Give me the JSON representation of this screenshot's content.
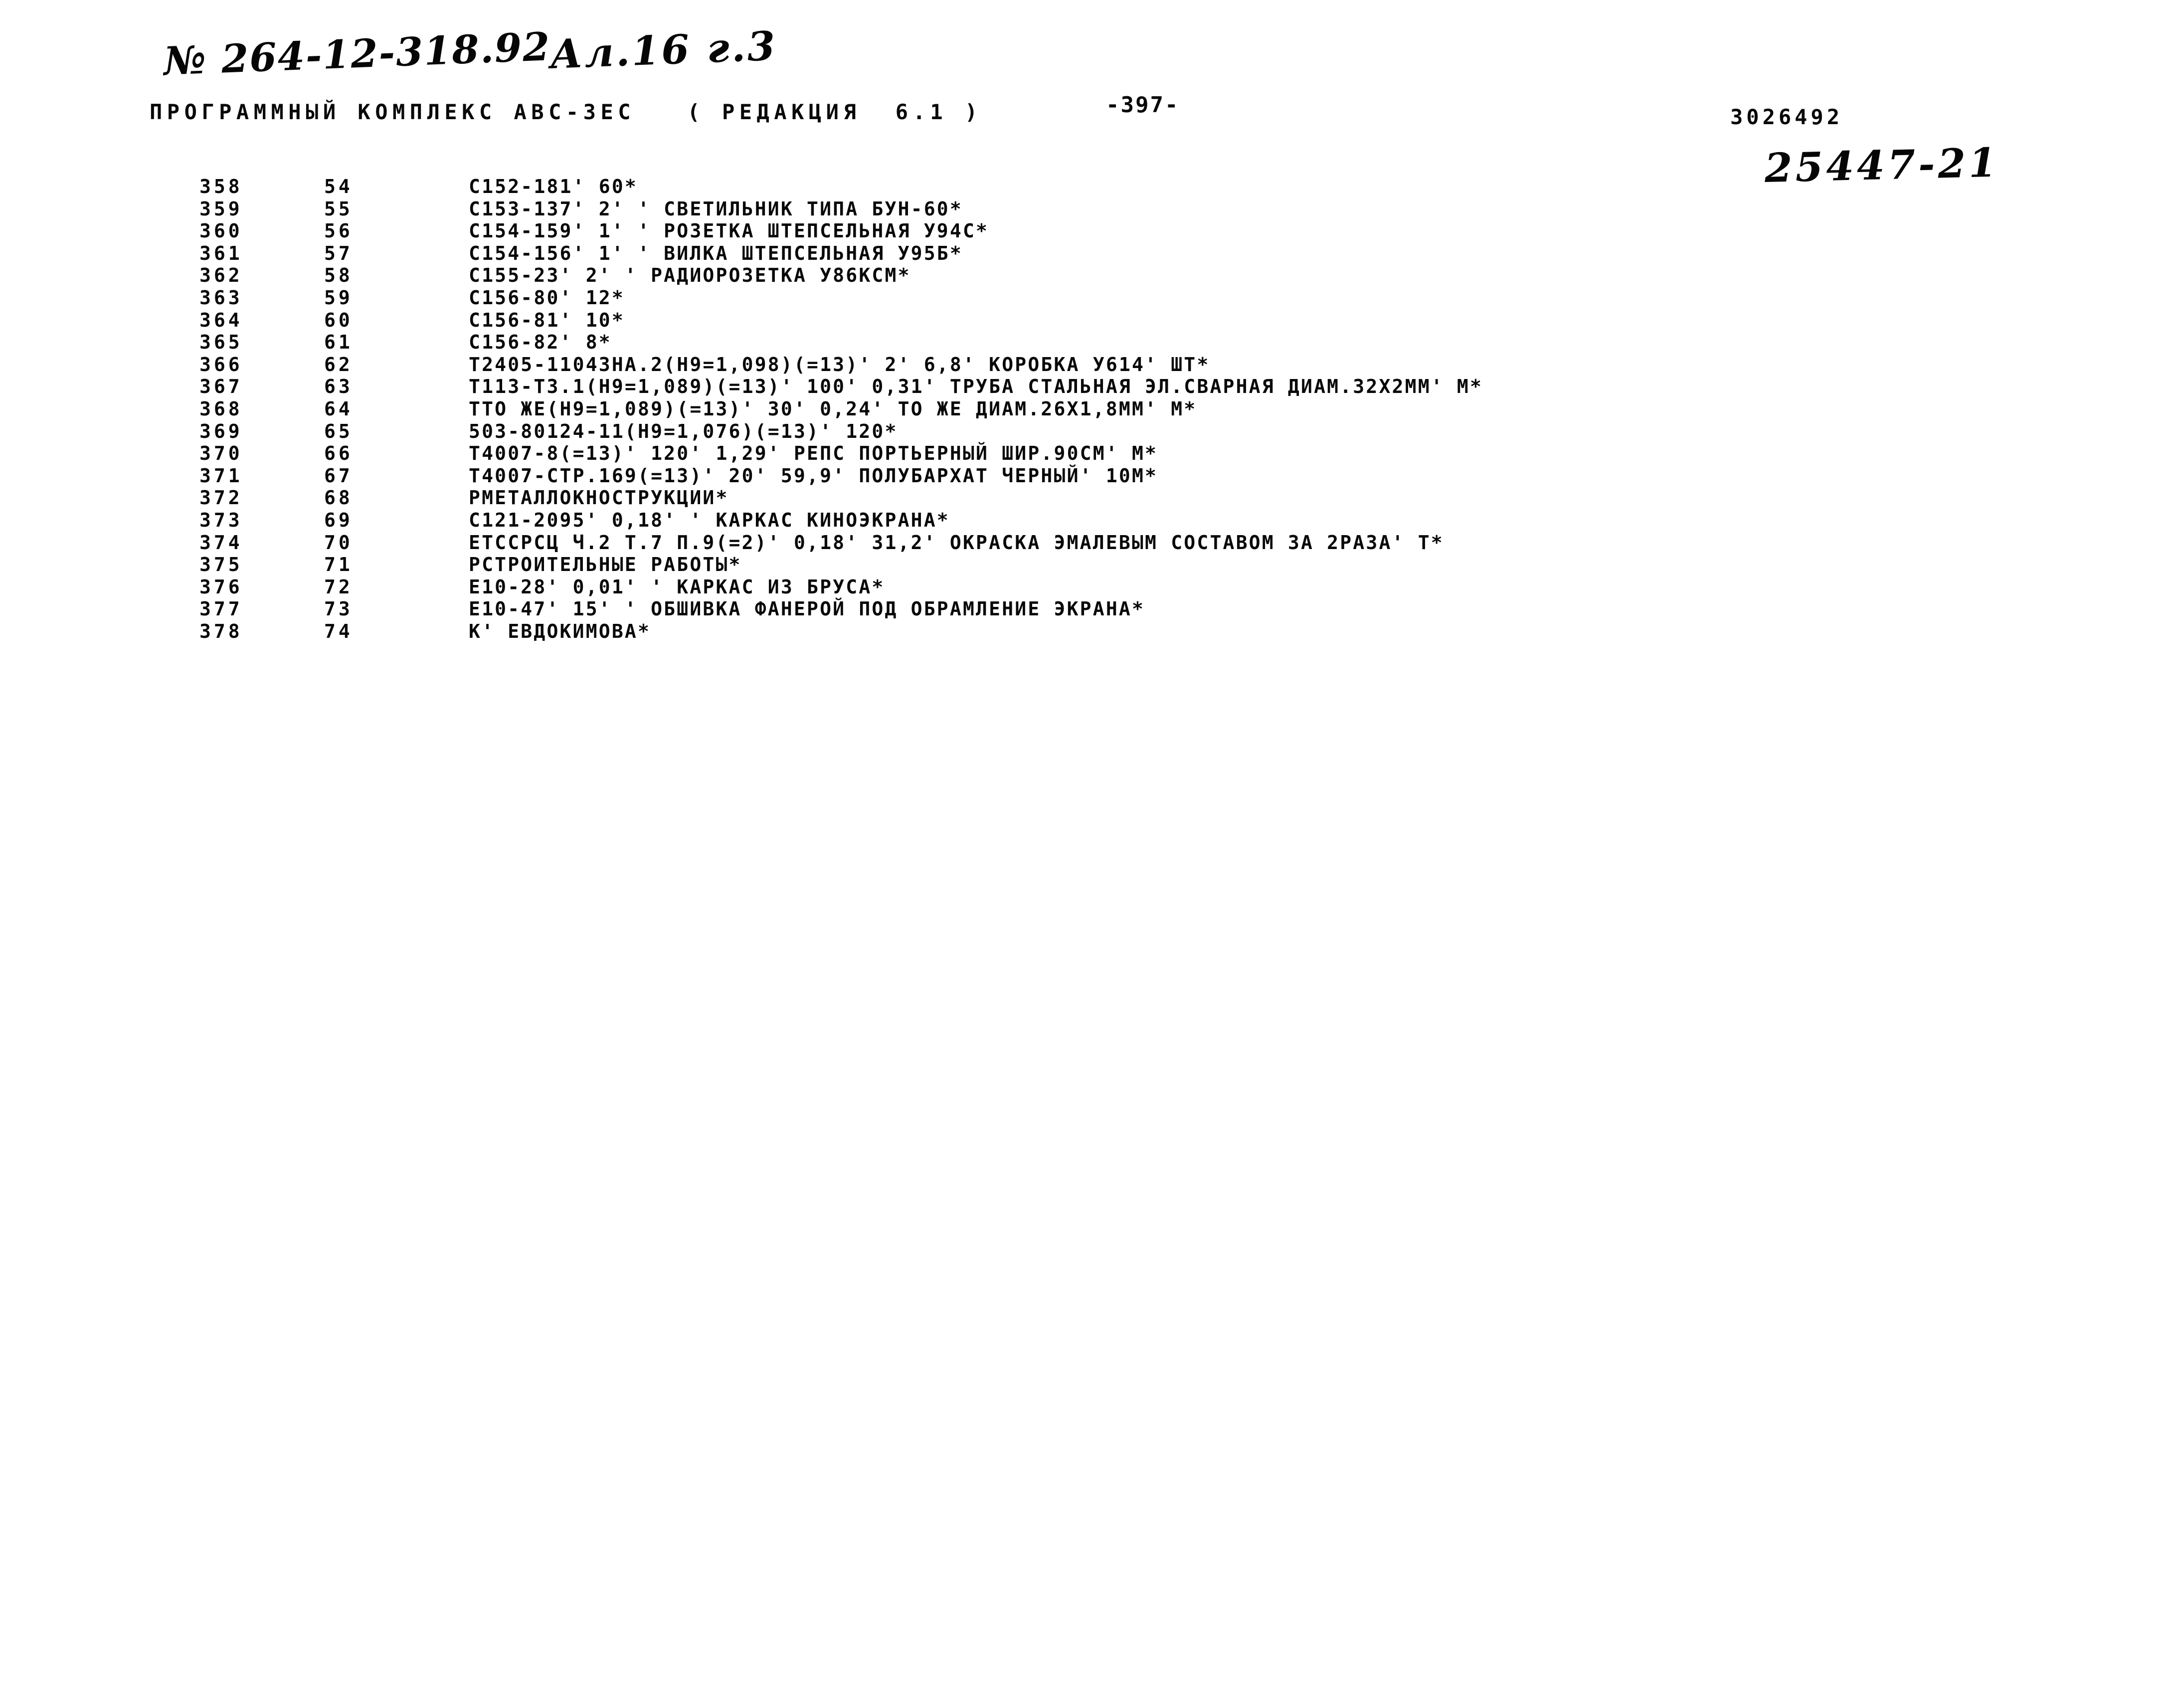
{
  "document": {
    "medium": "scanned dot-matrix printout",
    "background_color": "#ffffff",
    "ink_color": "#080808"
  },
  "annotations": {
    "order_number": "№ 264-12-318.92",
    "album_reference": "Ал.16 г.3",
    "archive_number": "25447-21"
  },
  "header": {
    "program_title": "ПРОГРАММНЫЙ КОМПЛЕКС АВС-3ЕС   ( РЕДАКЦИЯ  6.1 )",
    "page_number": "-397-",
    "document_code": "3026492"
  },
  "listing": {
    "columns": [
      "line_no",
      "seq_no",
      "record"
    ],
    "rows": [
      {
        "line_no": "358",
        "seq_no": "54",
        "record": "C152-181' 60*"
      },
      {
        "line_no": "359",
        "seq_no": "55",
        "record": "C153-137' 2' ' СВЕТИЛЬНИК ТИПА БУН-60*"
      },
      {
        "line_no": "360",
        "seq_no": "56",
        "record": "C154-159' 1' ' РОЗЕТКА ШТЕПСЕЛЬНАЯ У94С*"
      },
      {
        "line_no": "361",
        "seq_no": "57",
        "record": "C154-156' 1' ' ВИЛКА ШТЕПСЕЛЬНАЯ У95Б*"
      },
      {
        "line_no": "362",
        "seq_no": "58",
        "record": "C155-23' 2' ' РАДИОРОЗЕТКА У86КСМ*"
      },
      {
        "line_no": "363",
        "seq_no": "59",
        "record": "C156-80' 12*"
      },
      {
        "line_no": "364",
        "seq_no": "60",
        "record": "C156-81' 10*"
      },
      {
        "line_no": "365",
        "seq_no": "61",
        "record": "C156-82' 8*"
      },
      {
        "line_no": "366",
        "seq_no": "62",
        "record": "Т2405-11043НА.2(Н9=1,098)(=13)' 2' 6,8' КОРОБКА У614' ШТ*"
      },
      {
        "line_no": "367",
        "seq_no": "63",
        "record": "Т113-Т3.1(Н9=1,089)(=13)' 100' 0,31' ТРУБА СТАЛЬНАЯ ЭЛ.СВАРНАЯ ДИАМ.32Х2ММ' М*"
      },
      {
        "line_no": "368",
        "seq_no": "64",
        "record": "ТТО ЖЕ(Н9=1,089)(=13)' 30' 0,24' ТО ЖЕ ДИАМ.26Х1,8ММ' М*"
      },
      {
        "line_no": "369",
        "seq_no": "65",
        "record": "503-80124-11(Н9=1,076)(=13)' 120*"
      },
      {
        "line_no": "370",
        "seq_no": "66",
        "record": "Т4007-8(=13)' 120' 1,29' РЕПС ПОРТЬЕРНЫЙ ШИР.90СМ' М*"
      },
      {
        "line_no": "371",
        "seq_no": "67",
        "record": "Т4007-СТР.169(=13)' 20' 59,9' ПОЛУБАРХАТ ЧЕРНЫЙ' 10М*"
      },
      {
        "line_no": "372",
        "seq_no": "68",
        "record": "РМЕТАЛЛОКНОСТРУКЦИИ*"
      },
      {
        "line_no": "373",
        "seq_no": "69",
        "record": "C121-2095' 0,18' ' КАРКАС КИНОЭКРАНА*"
      },
      {
        "line_no": "374",
        "seq_no": "70",
        "record": "ЕТССРСЦ Ч.2 Т.7 П.9(=2)' 0,18' 31,2' ОКРАСКА ЭМАЛЕВЫМ СОСТАВОМ ЗА 2РАЗА' Т*"
      },
      {
        "line_no": "375",
        "seq_no": "71",
        "record": "РСТРОИТЕЛЬНЫЕ РАБОТЫ*"
      },
      {
        "line_no": "376",
        "seq_no": "72",
        "record": "Е10-28' 0,01' ' КАРКАС ИЗ БРУСА*"
      },
      {
        "line_no": "377",
        "seq_no": "73",
        "record": "Е10-47' 15' ' ОБШИВКА ФАНЕРОЙ ПОД ОБРАМЛЕНИЕ ЭКРАНА*"
      },
      {
        "line_no": "378",
        "seq_no": "74",
        "record": "К' ЕВДОКИМОВА*"
      }
    ]
  }
}
